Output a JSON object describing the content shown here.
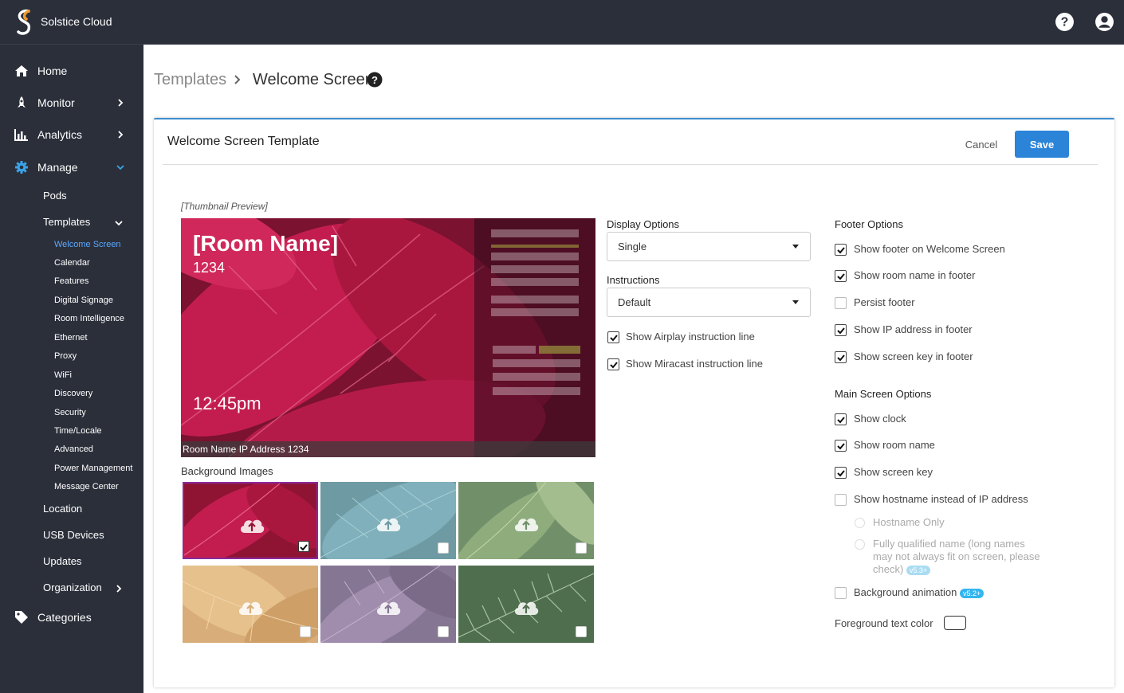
{
  "app": {
    "title": "Solstice Cloud"
  },
  "sidebar": {
    "items": [
      {
        "label": "Home"
      },
      {
        "label": "Monitor"
      },
      {
        "label": "Analytics"
      },
      {
        "label": "Manage"
      }
    ],
    "manage_children": [
      "Pods",
      "Templates",
      "Location",
      "USB Devices",
      "Updates",
      "Organization"
    ],
    "templates_children": [
      "Welcome Screen",
      "Calendar",
      "Features",
      "Digital Signage",
      "Room Intelligence",
      "Ethernet",
      "Proxy",
      "WiFi",
      "Discovery",
      "Security",
      "Time/Locale",
      "Advanced",
      "Power Management",
      "Message Center"
    ],
    "categories": "Categories"
  },
  "breadcrumb": {
    "parent": "Templates",
    "current": "Welcome Screen"
  },
  "card": {
    "title": "Welcome Screen Template",
    "cancel": "Cancel",
    "save": "Save",
    "thumbnail_label": "[Thumbnail Preview]"
  },
  "preview": {
    "room_name": "[Room Name]",
    "number": "1234",
    "time": "12:45pm",
    "footer": "Room Name IP Address 1234"
  },
  "background_images": {
    "label": "Background Images",
    "tiles": [
      {
        "name": "red leaves",
        "color": "#a01840",
        "selected": true
      },
      {
        "name": "teal leaves",
        "color": "#5d96a4",
        "selected": false
      },
      {
        "name": "green leaves",
        "color": "#7b9a6a",
        "selected": false
      },
      {
        "name": "tan leaves",
        "color": "#d4aa74",
        "selected": false
      },
      {
        "name": "purple leaves",
        "color": "#8a7895",
        "selected": false
      },
      {
        "name": "pine needles",
        "color": "#557a54",
        "selected": false
      }
    ]
  },
  "display_options": {
    "label": "Display Options",
    "value": "Single"
  },
  "instructions": {
    "label": "Instructions",
    "value": "Default"
  },
  "instruction_lines": [
    {
      "label": "Show Airplay instruction line",
      "checked": true
    },
    {
      "label": "Show Miracast instruction line",
      "checked": true
    }
  ],
  "footer_options": {
    "label": "Footer Options",
    "items": [
      {
        "label": "Show footer on Welcome Screen",
        "checked": true
      },
      {
        "label": "Show room name in footer",
        "checked": true
      },
      {
        "label": "Persist footer",
        "checked": false
      },
      {
        "label": "Show IP address in footer",
        "checked": true
      },
      {
        "label": "Show screen key in footer",
        "checked": true
      }
    ]
  },
  "main_screen_options": {
    "label": "Main Screen Options",
    "items": [
      {
        "label": "Show clock",
        "checked": true
      },
      {
        "label": "Show room name",
        "checked": true
      },
      {
        "label": "Show screen key",
        "checked": true
      },
      {
        "label": "Show hostname instead of IP address",
        "checked": false
      }
    ],
    "hostname_only": "Hostname Only",
    "fqdn_line1": "Fully qualified name (long names",
    "fqdn_line2": "may not always fit on screen, please",
    "fqdn_line3": "check)",
    "fqdn_badge": "v5.3+",
    "background_animation": "Background animation",
    "background_animation_badge": "v5.2+",
    "foreground_text_color": "Foreground text color"
  },
  "colors": {
    "accent": "#2c84d8",
    "sidebar": "#2b2f3a",
    "active_link": "#5ba8ff",
    "selected_tile": "#8b2a9c"
  }
}
